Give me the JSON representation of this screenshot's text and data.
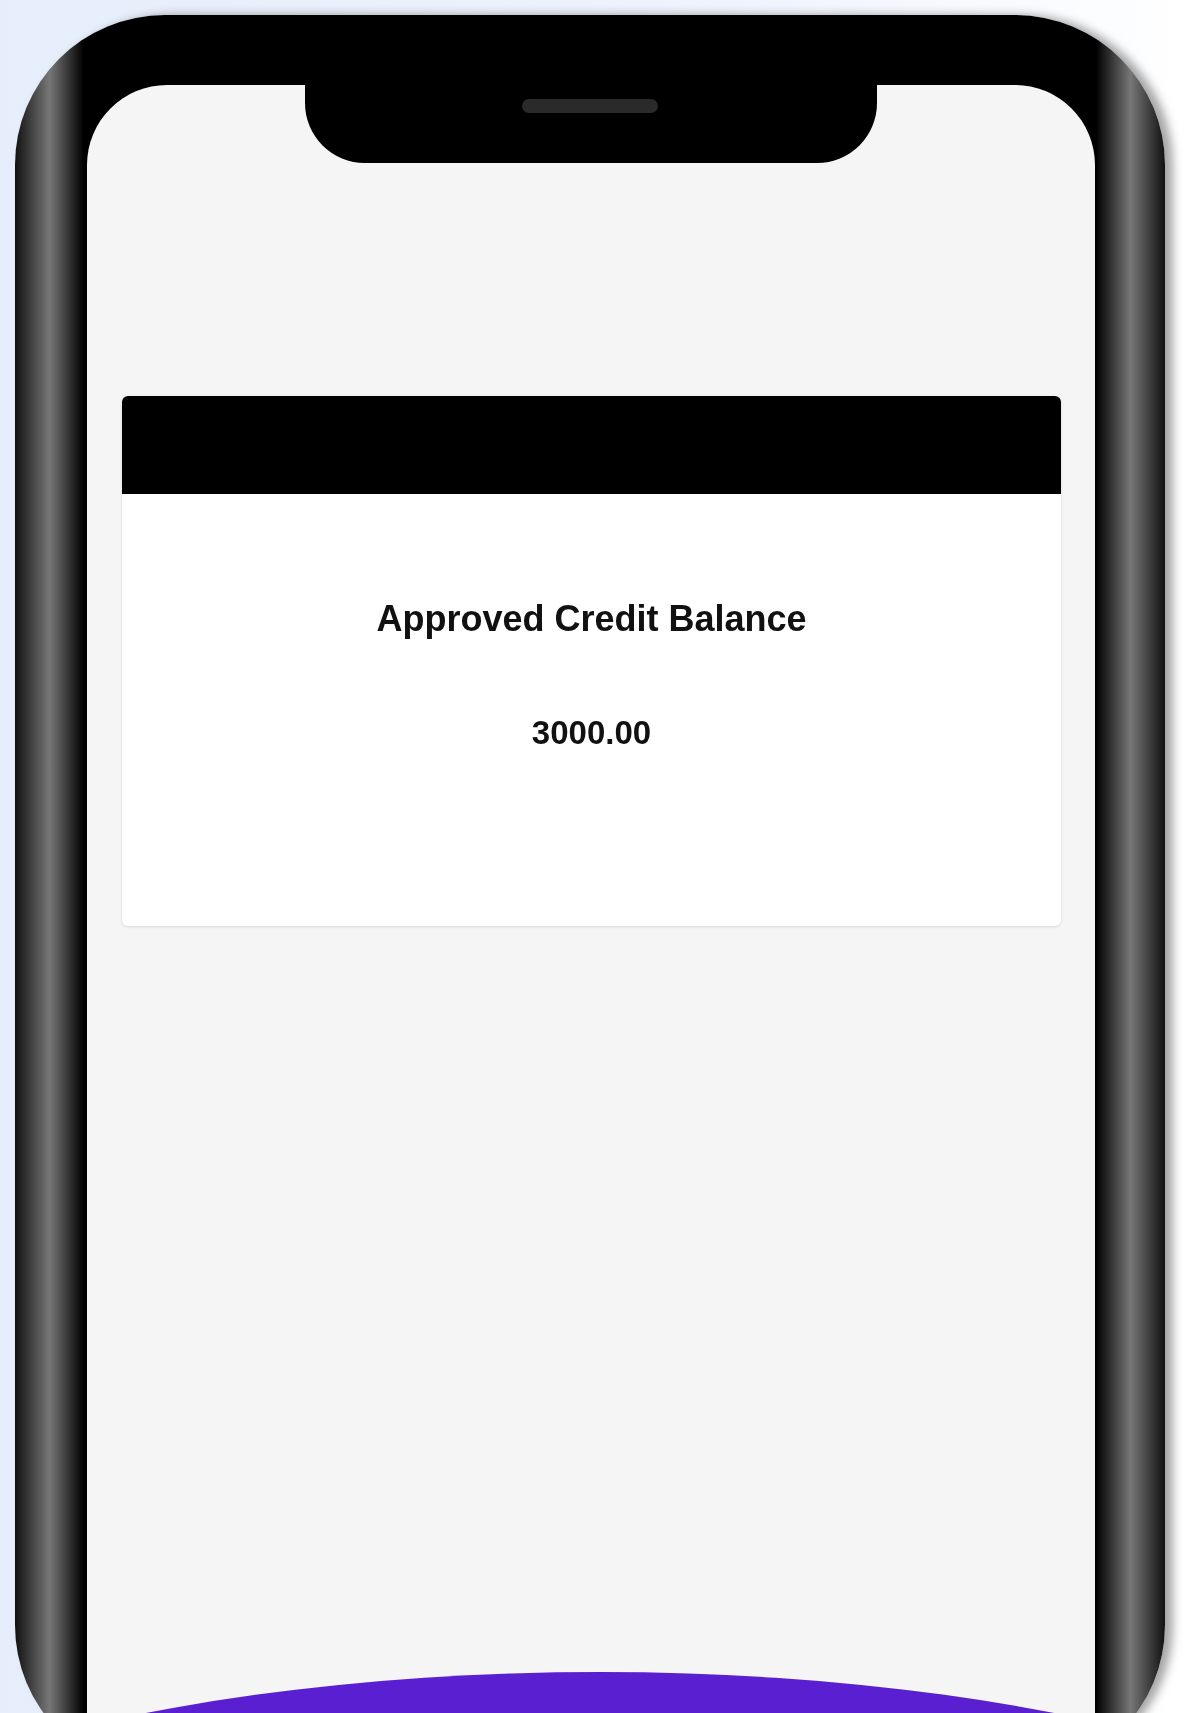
{
  "card": {
    "title": "Approved Credit Balance",
    "amount": "3000.00"
  }
}
